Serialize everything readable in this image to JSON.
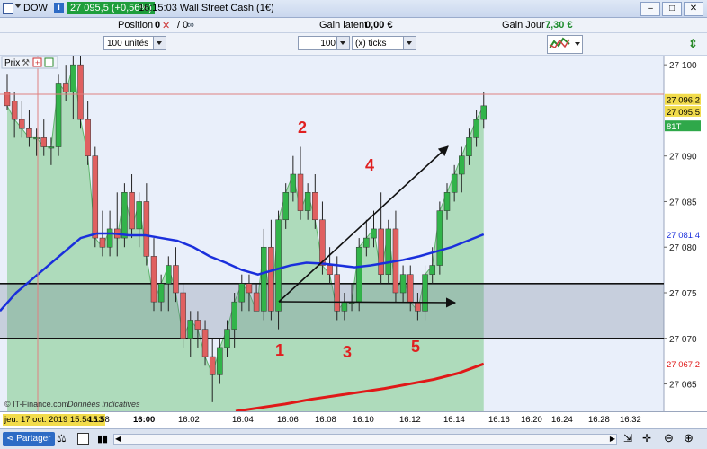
{
  "titlebar": {
    "symbol": "DOW",
    "price_badge": "27 095,5 (+0,56%)",
    "title": "16:15:03  Wall Street Cash (1€)",
    "btn_min": "–",
    "btn_max": "□",
    "btn_close": "✕"
  },
  "positions": {
    "position_label": "Position :",
    "position_value": "0",
    "position_sep": "/ 0",
    "gain_latent_label": "Gain latent :",
    "gain_latent_value": "0,00 €",
    "gain_jour_label": "Gain Jour :",
    "gain_jour_value": "7,30 €"
  },
  "toolbar": {
    "units_select": "100 unités",
    "ticks_value": "100",
    "ticks_select": "(x) ticks"
  },
  "chart": {
    "panel_label": "Prix",
    "copyright": "© IT-Finance.com",
    "disclaimer": "Données indicatives",
    "price_labels": [
      "27 100",
      "27 090",
      "27 085",
      "27 080",
      "27 075",
      "27 070",
      "27 065"
    ],
    "marker_last": "27 096,2",
    "marker_second": "27 095,5",
    "marker_ticks": "81T",
    "marker_ma_blue": "27 081,4",
    "marker_ma_red": "27 067,2",
    "time_current": "jeu. 17 oct. 2019 15:54:13",
    "time_labels": [
      "15:58",
      "16:00",
      "16:02",
      "16:04",
      "16:06",
      "16:08",
      "16:10",
      "16:12",
      "16:14",
      "16:16",
      "16:20",
      "16:24",
      "16:28",
      "16:32"
    ],
    "annotations": [
      "1",
      "2",
      "3",
      "4",
      "5"
    ],
    "colors": {
      "up": "#32b44a",
      "down": "#e06060",
      "ma_blue": "#1a2fdc",
      "ma_red": "#e01818",
      "annotation": "#e02020"
    }
  },
  "chart_data": {
    "type": "candlestick",
    "y_range": [
      27062,
      27101
    ],
    "x_range": [
      "15:58",
      "16:32"
    ],
    "last_price": 27095.5,
    "horizontal_levels": [
      27076,
      27070
    ],
    "candles": [
      {
        "o": 27097,
        "h": 27099,
        "l": 27095,
        "c": 27095.5
      },
      {
        "o": 27096,
        "h": 27097,
        "l": 27092,
        "c": 27094
      },
      {
        "o": 27094,
        "h": 27096,
        "l": 27092,
        "c": 27093
      },
      {
        "o": 27093,
        "h": 27095,
        "l": 27091,
        "c": 27092
      },
      {
        "o": 27092,
        "h": 27093,
        "l": 27090,
        "c": 27092
      },
      {
        "o": 27092,
        "h": 27094,
        "l": 27090,
        "c": 27091
      },
      {
        "o": 27091,
        "h": 27092,
        "l": 27089,
        "c": 27091
      },
      {
        "o": 27091,
        "h": 27099,
        "l": 27090,
        "c": 27098
      },
      {
        "o": 27098,
        "h": 27100,
        "l": 27096,
        "c": 27097
      },
      {
        "o": 27097,
        "h": 27101,
        "l": 27094,
        "c": 27100
      },
      {
        "o": 27100,
        "h": 27101,
        "l": 27093,
        "c": 27094
      },
      {
        "o": 27094,
        "h": 27096,
        "l": 27089,
        "c": 27090
      },
      {
        "o": 27090,
        "h": 27091,
        "l": 27080,
        "c": 27081
      },
      {
        "o": 27081,
        "h": 27084,
        "l": 27079,
        "c": 27080
      },
      {
        "o": 27080,
        "h": 27084,
        "l": 27079,
        "c": 27082
      },
      {
        "o": 27082,
        "h": 27086,
        "l": 27079,
        "c": 27081
      },
      {
        "o": 27081,
        "h": 27087,
        "l": 27080,
        "c": 27086
      },
      {
        "o": 27086,
        "h": 27088,
        "l": 27081,
        "c": 27082
      },
      {
        "o": 27082,
        "h": 27086,
        "l": 27080,
        "c": 27085
      },
      {
        "o": 27085,
        "h": 27087,
        "l": 27078,
        "c": 27079
      },
      {
        "o": 27079,
        "h": 27081,
        "l": 27073,
        "c": 27074
      },
      {
        "o": 27074,
        "h": 27077,
        "l": 27073,
        "c": 27076
      },
      {
        "o": 27076,
        "h": 27079,
        "l": 27073,
        "c": 27078
      },
      {
        "o": 27078,
        "h": 27080,
        "l": 27074,
        "c": 27075
      },
      {
        "o": 27075,
        "h": 27076,
        "l": 27069,
        "c": 27070
      },
      {
        "o": 27070,
        "h": 27073,
        "l": 27068,
        "c": 27072
      },
      {
        "o": 27072,
        "h": 27073,
        "l": 27069,
        "c": 27071
      },
      {
        "o": 27071,
        "h": 27072,
        "l": 27067,
        "c": 27068
      },
      {
        "o": 27068,
        "h": 27070,
        "l": 27063,
        "c": 27066
      },
      {
        "o": 27066,
        "h": 27070,
        "l": 27065,
        "c": 27069
      },
      {
        "o": 27069,
        "h": 27072,
        "l": 27068,
        "c": 27071
      },
      {
        "o": 27071,
        "h": 27075,
        "l": 27069,
        "c": 27074
      },
      {
        "o": 27074,
        "h": 27077,
        "l": 27073,
        "c": 27076
      },
      {
        "o": 27076,
        "h": 27077,
        "l": 27073,
        "c": 27075
      },
      {
        "o": 27075,
        "h": 27076,
        "l": 27073,
        "c": 27073
      },
      {
        "o": 27073,
        "h": 27082,
        "l": 27072,
        "c": 27080
      },
      {
        "o": 27080,
        "h": 27083,
        "l": 27072,
        "c": 27073
      },
      {
        "o": 27073,
        "h": 27084,
        "l": 27071,
        "c": 27083
      },
      {
        "o": 27083,
        "h": 27087,
        "l": 27082,
        "c": 27086
      },
      {
        "o": 27086,
        "h": 27090,
        "l": 27085,
        "c": 27088
      },
      {
        "o": 27088,
        "h": 27091,
        "l": 27083,
        "c": 27084
      },
      {
        "o": 27084,
        "h": 27087,
        "l": 27083,
        "c": 27086
      },
      {
        "o": 27086,
        "h": 27088,
        "l": 27082,
        "c": 27083
      },
      {
        "o": 27083,
        "h": 27085,
        "l": 27077,
        "c": 27078
      },
      {
        "o": 27078,
        "h": 27080,
        "l": 27076,
        "c": 27077
      },
      {
        "o": 27077,
        "h": 27079,
        "l": 27072,
        "c": 27073
      },
      {
        "o": 27073,
        "h": 27075,
        "l": 27072,
        "c": 27074
      },
      {
        "o": 27074,
        "h": 27076,
        "l": 27073,
        "c": 27074
      },
      {
        "o": 27074,
        "h": 27081,
        "l": 27073,
        "c": 27080
      },
      {
        "o": 27080,
        "h": 27083,
        "l": 27079,
        "c": 27081
      },
      {
        "o": 27081,
        "h": 27084,
        "l": 27080,
        "c": 27082
      },
      {
        "o": 27082,
        "h": 27086,
        "l": 27076,
        "c": 27077
      },
      {
        "o": 27077,
        "h": 27083,
        "l": 27076,
        "c": 27082
      },
      {
        "o": 27082,
        "h": 27084,
        "l": 27074,
        "c": 27075
      },
      {
        "o": 27075,
        "h": 27078,
        "l": 27074,
        "c": 27077
      },
      {
        "o": 27077,
        "h": 27078,
        "l": 27073,
        "c": 27074
      },
      {
        "o": 27074,
        "h": 27075,
        "l": 27072,
        "c": 27073
      },
      {
        "o": 27073,
        "h": 27078,
        "l": 27072,
        "c": 27077
      },
      {
        "o": 27077,
        "h": 27080,
        "l": 27076,
        "c": 27078
      },
      {
        "o": 27078,
        "h": 27085,
        "l": 27077,
        "c": 27084
      },
      {
        "o": 27084,
        "h": 27087,
        "l": 27083,
        "c": 27086
      },
      {
        "o": 27086,
        "h": 27089,
        "l": 27085,
        "c": 27088
      },
      {
        "o": 27088,
        "h": 27091,
        "l": 27086,
        "c": 27090
      },
      {
        "o": 27090,
        "h": 27093,
        "l": 27089,
        "c": 27092
      },
      {
        "o": 27092,
        "h": 27095,
        "l": 27091,
        "c": 27094
      },
      {
        "o": 27094,
        "h": 27097,
        "l": 27093,
        "c": 27095.5
      }
    ],
    "ma_blue": [
      27073,
      27075,
      27076.5,
      27078,
      27079.5,
      27081,
      27081.5,
      27081.5,
      27081.3,
      27081.3,
      27081,
      27080.7,
      27080,
      27079,
      27078.3,
      27077.5,
      27077,
      27077.5,
      27078,
      27078.3,
      27078.2,
      27078,
      27077.8,
      27078,
      27078.3,
      27078.6,
      27079,
      27079.5,
      27080,
      27080.7,
      27081.4
    ],
    "ma_red": [
      27062,
      27062.4,
      27062.8,
      27063.3,
      27063.7,
      27064.1,
      27064.5,
      27065,
      27065.5,
      27066.2,
      27067.2
    ]
  },
  "footer": {
    "share_label": "Partager"
  }
}
